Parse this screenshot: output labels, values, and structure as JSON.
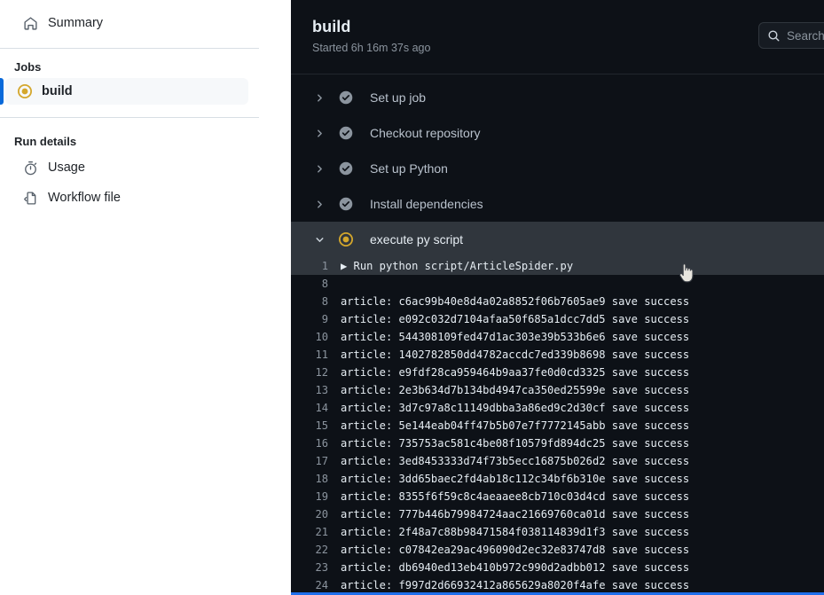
{
  "sidebar": {
    "summary": {
      "label": "Summary",
      "icon": "home-icon"
    },
    "jobs_label": "Jobs",
    "jobs": [
      {
        "label": "build",
        "icon": "in-progress-icon",
        "status": "in_progress"
      }
    ],
    "run_details_label": "Run details",
    "run_details": [
      {
        "label": "Usage",
        "icon": "stopwatch-icon"
      },
      {
        "label": "Workflow file",
        "icon": "file-code-icon"
      }
    ]
  },
  "header": {
    "title": "build",
    "subtitle": "Started 6h 16m 37s ago",
    "search_placeholder": "Search logs",
    "search_icon": "search-icon"
  },
  "steps": [
    {
      "label": "Set up job",
      "status": "success",
      "expanded": false,
      "chevron": "chevron-right-icon"
    },
    {
      "label": "Checkout repository",
      "status": "success",
      "expanded": false,
      "chevron": "chevron-right-icon"
    },
    {
      "label": "Set up Python",
      "status": "success",
      "expanded": false,
      "chevron": "chevron-right-icon"
    },
    {
      "label": "Install dependencies",
      "status": "success",
      "expanded": false,
      "chevron": "chevron-right-icon"
    },
    {
      "label": "execute py script",
      "status": "in_progress",
      "expanded": true,
      "chevron": "chevron-down-icon"
    }
  ],
  "log": {
    "lines": [
      {
        "n": "1",
        "text": "▶ Run python script/ArticleSpider.py",
        "highlight": true,
        "group": true
      },
      {
        "n": "8",
        "text": "",
        "highlight": false,
        "group": false
      },
      {
        "n": "8",
        "text": "article: c6ac99b40e8d4a02a8852f06b7605ae9 save success",
        "highlight": false,
        "group": false
      },
      {
        "n": "9",
        "text": "article: e092c032d7104afaa50f685a1dcc7dd5 save success",
        "highlight": false,
        "group": false
      },
      {
        "n": "10",
        "text": "article: 544308109fed47d1ac303e39b533b6e6 save success",
        "highlight": false,
        "group": false
      },
      {
        "n": "11",
        "text": "article: 1402782850dd4782accdc7ed339b8698 save success",
        "highlight": false,
        "group": false
      },
      {
        "n": "12",
        "text": "article: e9fdf28ca959464b9aa37fe0d0cd3325 save success",
        "highlight": false,
        "group": false
      },
      {
        "n": "13",
        "text": "article: 2e3b634d7b134bd4947ca350ed25599e save success",
        "highlight": false,
        "group": false
      },
      {
        "n": "14",
        "text": "article: 3d7c97a8c11149dbba3a86ed9c2d30cf save success",
        "highlight": false,
        "group": false
      },
      {
        "n": "15",
        "text": "article: 5e144eab04ff47b5b07e7f7772145abb save success",
        "highlight": false,
        "group": false
      },
      {
        "n": "16",
        "text": "article: 735753ac581c4be08f10579fd894dc25 save success",
        "highlight": false,
        "group": false
      },
      {
        "n": "17",
        "text": "article: 3ed8453333d74f73b5ecc16875b026d2 save success",
        "highlight": false,
        "group": false
      },
      {
        "n": "18",
        "text": "article: 3dd65baec2fd4ab18c112c34bf6b310e save success",
        "highlight": false,
        "group": false
      },
      {
        "n": "19",
        "text": "article: 8355f6f59c8c4aeaaee8cb710c03d4cd save success",
        "highlight": false,
        "group": false
      },
      {
        "n": "20",
        "text": "article: 777b446b79984724aac21669760ca01d save success",
        "highlight": false,
        "group": false
      },
      {
        "n": "21",
        "text": "article: 2f48a7c88b98471584f038114839d1f3 save success",
        "highlight": false,
        "group": false
      },
      {
        "n": "22",
        "text": "article: c07842ea29ac496090d2ec32e83747d8 save success",
        "highlight": false,
        "group": false
      },
      {
        "n": "23",
        "text": "article: db6940ed13eb410b972c990d2adbb012 save success",
        "highlight": false,
        "group": false
      },
      {
        "n": "24",
        "text": "article: f997d2d66932412a865629a8020f4afe save success",
        "highlight": false,
        "group": false
      }
    ]
  },
  "colors": {
    "accent_blue": "#0969da",
    "progress_yellow": "#d4a72c",
    "panel_bg": "#0d1117",
    "row_highlight": "#30363d",
    "bottom_bar": "#1f6feb"
  }
}
